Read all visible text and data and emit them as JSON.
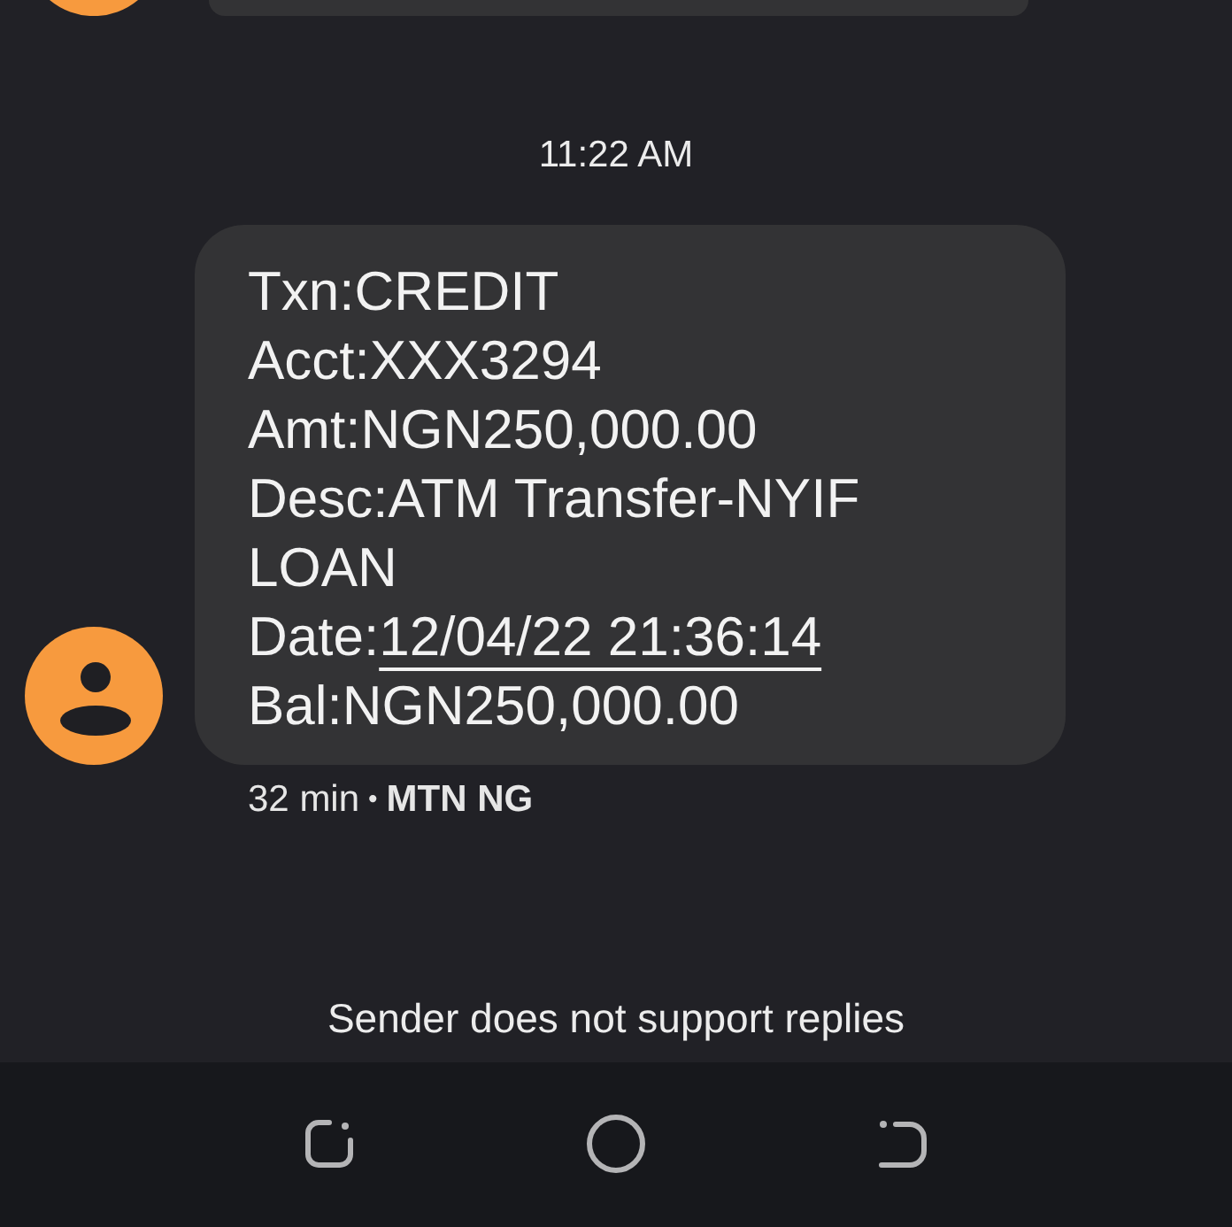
{
  "timestamp": "11:22 AM",
  "message": {
    "lines": [
      {
        "text": "Txn:CREDIT"
      },
      {
        "text": "Acct:XXX3294"
      },
      {
        "text": "Amt:NGN250,000.00"
      },
      {
        "text": "Desc:ATM Transfer-NYIF LOAN"
      },
      {
        "text": "Date:",
        "link": "12/04/22 21:36:14"
      },
      {
        "text": "Bal:NGN250,000.00"
      }
    ]
  },
  "meta": {
    "age": "32 min",
    "separator": "•",
    "sender": "MTN NG"
  },
  "reply_notice": "Sender does not support replies"
}
